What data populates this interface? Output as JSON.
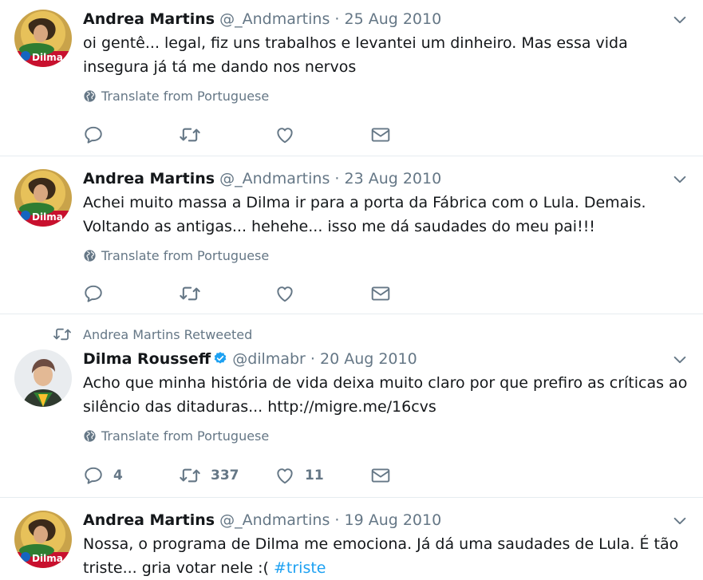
{
  "tweets": [
    {
      "author": "Andrea Martins",
      "handle": "@_Andmartins",
      "sep": "·",
      "date": "25 Aug 2010",
      "text": "oi gentê... legal, fiz uns trabalhos e levantei um dinheiro. Mas essa vida insegura já tá me dando nos nervos",
      "translate": "Translate from Portuguese",
      "avatar_label": "Dilma"
    },
    {
      "author": "Andrea Martins",
      "handle": "@_Andmartins",
      "sep": "·",
      "date": "23 Aug 2010",
      "text": "Achei muito massa a Dilma ir para a porta da Fábrica com o Lula. Demais. Voltando as antigas... hehehe... isso me dá saudades do meu pai!!!",
      "translate": "Translate from Portuguese",
      "avatar_label": "Dilma"
    },
    {
      "retweeted_by": "Andrea Martins Retweeted",
      "author": "Dilma Rousseff",
      "handle": "@dilmabr",
      "sep": "·",
      "date": "20 Aug 2010",
      "text": "Acho que minha história de vida deixa muito claro por que prefiro as críticas ao silêncio das ditaduras... http://migre.me/16cvs",
      "translate": "Translate from Portuguese",
      "replies": "4",
      "retweets": "337",
      "likes": "11"
    },
    {
      "author": "Andrea Martins",
      "handle": "@_Andmartins",
      "sep": "·",
      "date": "19 Aug 2010",
      "text": "Nossa, o programa de Dilma me emociona. Já dá uma saudades de Lula. É tão triste... gria votar nele :(",
      "hashtag": "#triste",
      "avatar_label": "Dilma"
    }
  ],
  "colors": {
    "text": "#14171a",
    "secondary": "#657786",
    "link": "#1da1f2",
    "divider": "#e6ecf0",
    "verified": "#1da1f2"
  },
  "icons": [
    "reply-icon",
    "retweet-icon",
    "like-icon",
    "message-icon",
    "globe-icon",
    "caret-down-icon",
    "verified-icon"
  ]
}
